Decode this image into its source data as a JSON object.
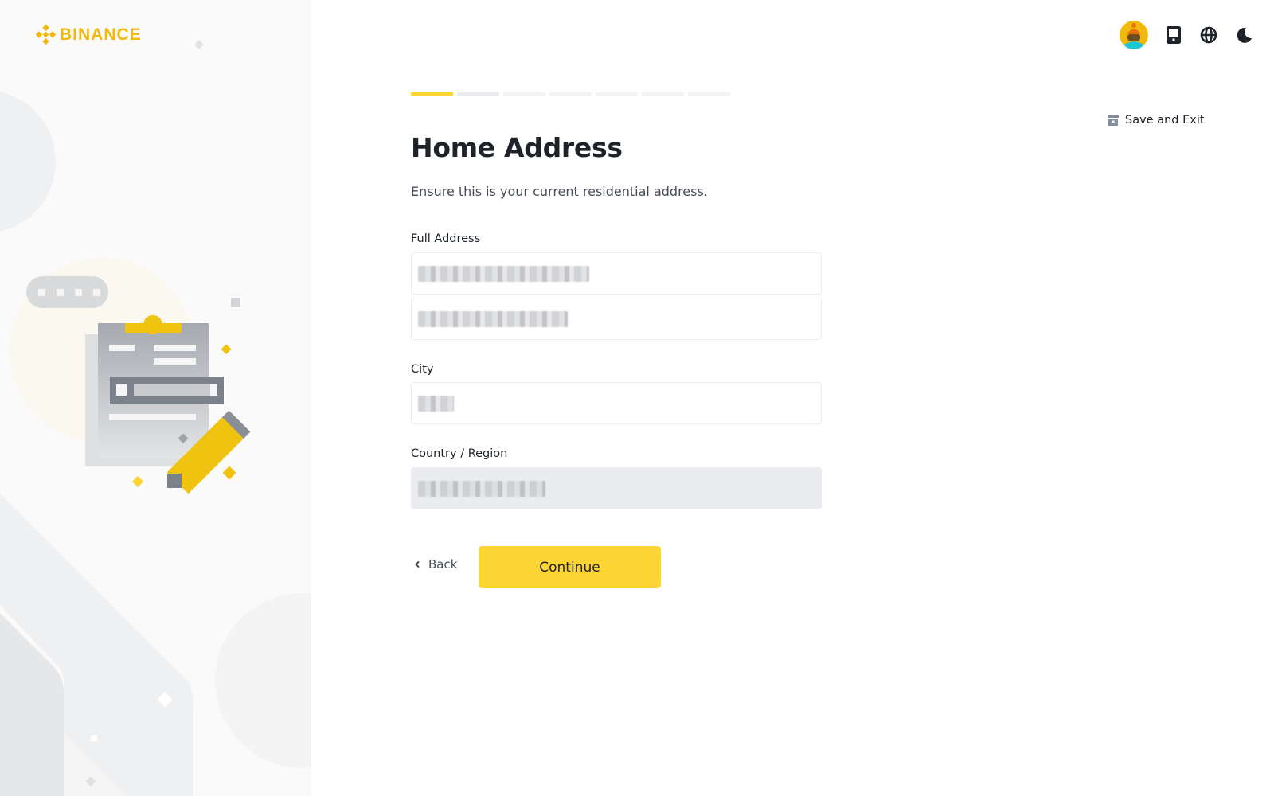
{
  "brand": {
    "name": "BINANCE",
    "color": "#f0b90b"
  },
  "header": {
    "icons": [
      {
        "name": "avatar",
        "label": "user avatar"
      },
      {
        "name": "tablet-icon",
        "label": "download app"
      },
      {
        "name": "globe-icon",
        "label": "language"
      },
      {
        "name": "moon-icon",
        "label": "dark mode"
      }
    ],
    "save_exit_label": "Save and Exit"
  },
  "progress": {
    "total_steps": 7,
    "current_step": 1
  },
  "form": {
    "title": "Home Address",
    "subtitle": "Ensure this is your current residential address.",
    "full_address_label": "Full Address",
    "address_line1_value": "[redacted]",
    "address_line2_value": "[redacted]",
    "city_label": "City",
    "city_value": "[redacted]",
    "country_label": "Country / Region",
    "country_value": "[redacted]"
  },
  "actions": {
    "back_label": "Back",
    "continue_label": "Continue"
  },
  "colors": {
    "accent": "#fcd535",
    "text_primary": "#1e2329",
    "text_secondary": "#474d57",
    "border": "#eaecef",
    "disabled_bg": "#eaecef"
  }
}
